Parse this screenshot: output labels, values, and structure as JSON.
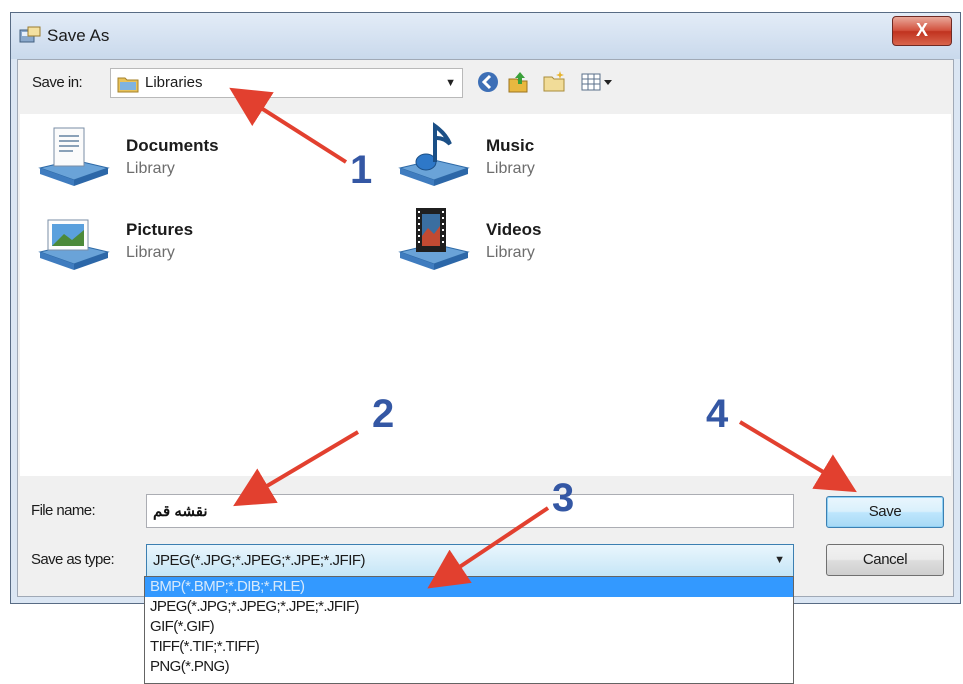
{
  "window": {
    "title": "Save As",
    "close_label": "X"
  },
  "save_in": {
    "label": "Save in:",
    "value": "Libraries"
  },
  "libraries": [
    {
      "name": "Documents",
      "type": "Library",
      "icon": "documents-library-icon"
    },
    {
      "name": "Music",
      "type": "Library",
      "icon": "music-library-icon"
    },
    {
      "name": "Pictures",
      "type": "Library",
      "icon": "pictures-library-icon"
    },
    {
      "name": "Videos",
      "type": "Library",
      "icon": "videos-library-icon"
    }
  ],
  "file_name": {
    "label": "File name:",
    "value": "نقشه قم"
  },
  "save_as_type": {
    "label": "Save as type:",
    "value": "JPEG(*.JPG;*.JPEG;*.JPE;*.JFIF)",
    "options": [
      "BMP(*.BMP;*.DIB;*.RLE)",
      "JPEG(*.JPG;*.JPEG;*.JPE;*.JFIF)",
      "GIF(*.GIF)",
      "TIFF(*.TIF;*.TIFF)",
      "PNG(*.PNG)"
    ],
    "highlighted_option": "BMP(*.BMP;*.DIB;*.RLE)"
  },
  "buttons": {
    "save": "Save",
    "cancel": "Cancel"
  },
  "annotations": [
    "1",
    "2",
    "3",
    "4"
  ],
  "colors": {
    "annotation_arrow": "#e2402f",
    "annotation_number": "#3457a4",
    "selection": "#3399ff"
  }
}
